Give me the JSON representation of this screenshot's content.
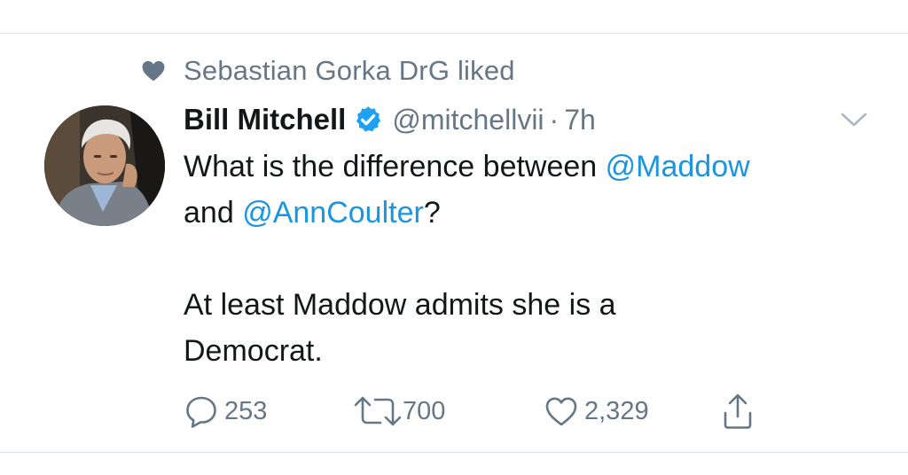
{
  "social_context": {
    "text": "Sebastian Gorka DrG liked",
    "icon": "heart-icon"
  },
  "tweet": {
    "author_name": "Bill Mitchell",
    "verified_icon": "verified-badge-icon",
    "handle": "@mitchellvii",
    "separator": "·",
    "timestamp": "7h",
    "text": {
      "line1_prefix": "What is the difference between ",
      "mention1": "@Maddow",
      "line2_prefix": "and ",
      "mention2": "@AnnCoulter",
      "line2_suffix": "?",
      "line3": "At least Maddow admits she is a",
      "line4": "Democrat."
    },
    "mention_color": "#1b95e0"
  },
  "actions": {
    "reply_count": "253",
    "retweet_count": "700",
    "like_count": "2,329",
    "reply_icon": "reply-icon",
    "retweet_icon": "retweet-icon",
    "like_icon": "heart-outline-icon",
    "share_icon": "share-icon"
  },
  "colors": {
    "text_primary": "#14171a",
    "text_secondary": "#657786",
    "link": "#1b95e0",
    "verified": "#1da1f2",
    "divider": "#e1e8ed"
  }
}
